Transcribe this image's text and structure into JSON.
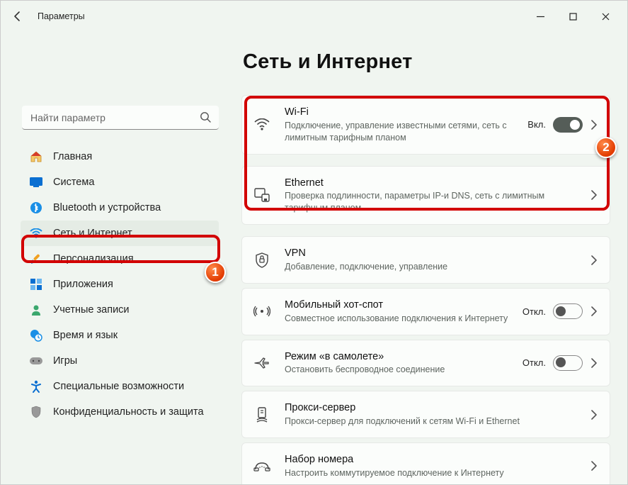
{
  "window": {
    "title": "Параметры"
  },
  "search": {
    "placeholder": "Найти параметр"
  },
  "nav": {
    "items": [
      {
        "label": "Главная"
      },
      {
        "label": "Система"
      },
      {
        "label": "Bluetooth и устройства"
      },
      {
        "label": "Сеть и Интернет"
      },
      {
        "label": "Персонализация"
      },
      {
        "label": "Приложения"
      },
      {
        "label": "Учетные записи"
      },
      {
        "label": "Время и язык"
      },
      {
        "label": "Игры"
      },
      {
        "label": "Специальные возможности"
      },
      {
        "label": "Конфиденциальность и защита"
      }
    ]
  },
  "page": {
    "title": "Сеть и Интернет"
  },
  "cards": {
    "wifi": {
      "title": "Wi-Fi",
      "sub": "Подключение, управление известными сетями, сеть с лимитным тарифным планом",
      "state": "Вкл."
    },
    "ethernet": {
      "title": "Ethernet",
      "sub": "Проверка подлинности, параметры IP-и DNS, сеть с лимитным тарифным планом"
    },
    "vpn": {
      "title": "VPN",
      "sub": "Добавление, подключение, управление"
    },
    "hotspot": {
      "title": "Мобильный хот-спот",
      "sub": "Совместное использование подключения к Интернету",
      "state": "Откл."
    },
    "airplane": {
      "title": "Режим «в самолете»",
      "sub": "Остановить беспроводное соединение",
      "state": "Откл."
    },
    "proxy": {
      "title": "Прокси-сервер",
      "sub": "Прокси-сервер для подключений к сетям Wi-Fi и Ethernet"
    },
    "dialup": {
      "title": "Набор номера",
      "sub": "Настроить коммутируемое подключение к Интернету"
    }
  },
  "badges": {
    "one": "1",
    "two": "2"
  }
}
